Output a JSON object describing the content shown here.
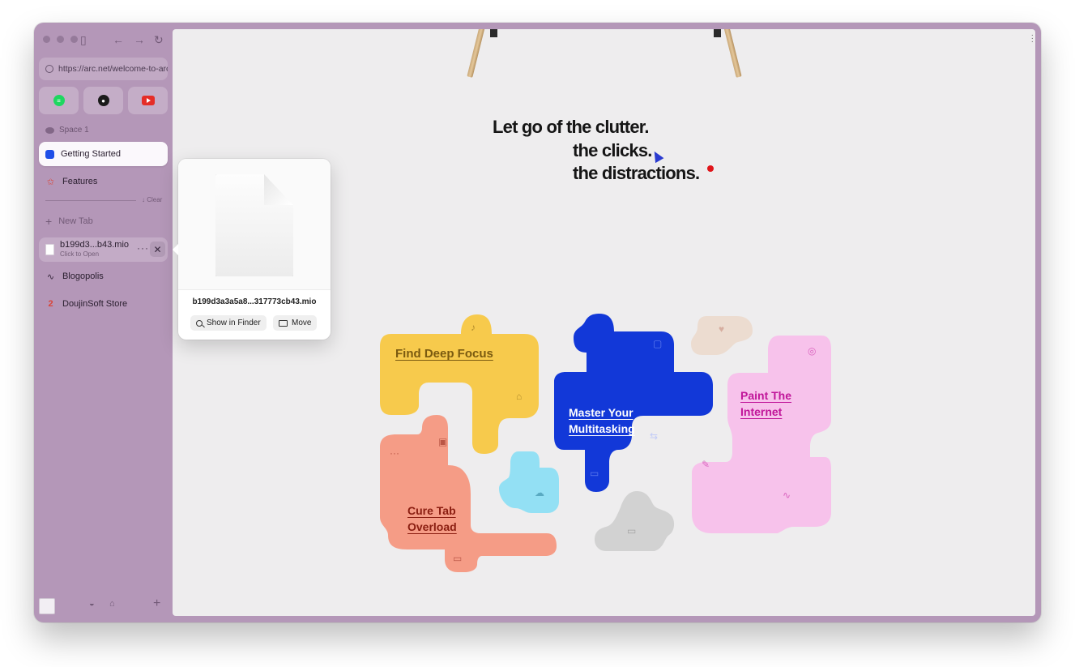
{
  "sidebar": {
    "url": "https://arc.net/welcome-to-arc",
    "favorites": [
      {
        "name": "Spotify",
        "icon": "spotify-icon",
        "color": "#1ed760"
      },
      {
        "name": "GitHub",
        "icon": "github-icon",
        "color": "#1b1b1b"
      },
      {
        "name": "YouTube",
        "icon": "youtube-icon",
        "color": "#e52d27"
      }
    ],
    "space_label": "Space 1",
    "pinned_tabs": [
      {
        "label": "Getting Started",
        "icon": "blue-square-icon",
        "active": true
      },
      {
        "label": "Features",
        "icon": "star-icon",
        "active": false
      }
    ],
    "clear_label": "↓ Clear",
    "new_tab_label": "New Tab",
    "download_tab": {
      "name": "b199d3...b43.mio",
      "subtitle": "Click to Open",
      "more": "···",
      "close": "✕"
    },
    "tabs": [
      {
        "label": "Blogopolis",
        "icon": "wave-icon"
      },
      {
        "label": "DoujinSoft Store",
        "icon": "doujinsoft-icon"
      }
    ]
  },
  "popover": {
    "filename": "b199d3a3a5a8...317773cb43.mio",
    "show_in_finder_label": "Show in Finder",
    "move_label": "Move"
  },
  "page": {
    "headline_line1": "Let go of the clutter.",
    "headline_line2": "the clicks.",
    "headline_line3": "the distractions.",
    "pieces": [
      {
        "label": "Find Deep Focus",
        "color": "#f7ca4c",
        "text_color": "#7a5a10"
      },
      {
        "label": "Master Your Multitasking",
        "color": "#1238d8",
        "text_color": "#ffffff"
      },
      {
        "label": "Paint The Internet",
        "color": "#f7c2eb",
        "text_color": "#c1169a"
      },
      {
        "label": "Cure Tab Overload",
        "color": "#f59c86",
        "text_color": "#8a1d10"
      }
    ]
  },
  "colors": {
    "sidebar_bg": "#b497b8",
    "active_tab_bg": "#fbf8fc",
    "content_bg": "#eeedee",
    "accent_blue": "#1f4fe8"
  }
}
